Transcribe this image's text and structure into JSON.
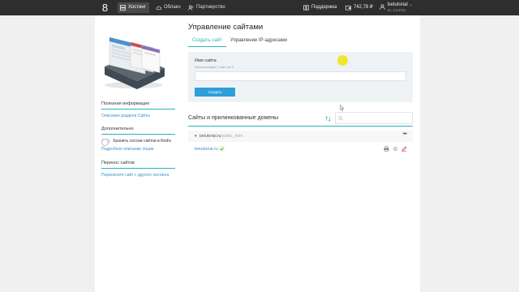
{
  "nav": {
    "logo": "8",
    "tabs": [
      {
        "label": "Хостинг",
        "icon": "server-icon"
      },
      {
        "label": "Облако",
        "icon": "cloud-icon"
      },
      {
        "label": "Партнерство",
        "icon": "people-icon"
      }
    ],
    "support_label": "Поддержка",
    "balance": "742,78 ₽",
    "user_name": "betutorial",
    "user_id": "ID: 1713703"
  },
  "sidebar": {
    "info_title": "Полезная информация",
    "info_link": "Описание раздела Сайты",
    "extra_title": "Дополнительно",
    "redis_toggle_label": "Хранить сессии сайтов в Redis",
    "redis_enabled": false,
    "details_link": "Подробное описание опции",
    "transfer_title": "Перенос сайтов",
    "transfer_link": "Перенесите сайт с другого хостинга"
  },
  "main": {
    "title": "Управление сайтами",
    "tabs": [
      "Создать сайт",
      "Управление IP-адресами"
    ],
    "form": {
      "name_label": "Имя сайта",
      "hint": "Использовано 1 сайт из 3",
      "name_value": "",
      "create_button": "Создать"
    },
    "sites": {
      "title": "Сайты и прилинкованные домены",
      "search_value": "",
      "group_name": "betutorial.ru",
      "group_path": "/public_html",
      "more_label": "•••",
      "domain": "betutorial.ru"
    }
  },
  "colors": {
    "accent": "#2bb3b8",
    "link": "#3b8ed6",
    "button": "#2e9fd8",
    "topbar": "#2e2e2e"
  }
}
